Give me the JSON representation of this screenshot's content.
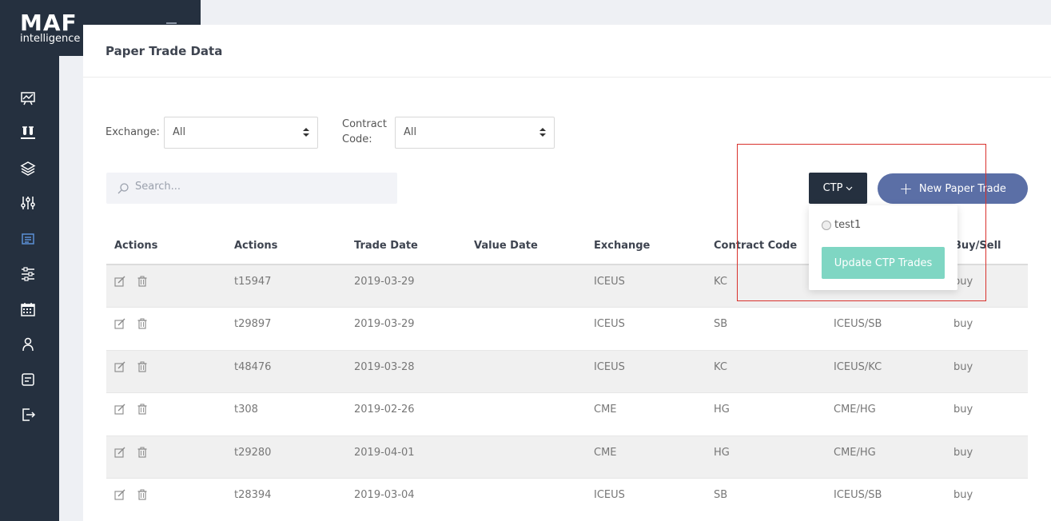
{
  "brand": {
    "name": "MAF",
    "sub": "intelligence"
  },
  "nav_icons": [
    "chart-icon",
    "lab-icon",
    "layers-icon",
    "sliders-icon",
    "news-icon",
    "settings-sliders-icon",
    "calendar-icon",
    "user-icon",
    "report-icon",
    "logout-icon"
  ],
  "page": {
    "title": "Paper Trade Data"
  },
  "filters": {
    "exchange_label": "Exchange:",
    "exchange_value": "All",
    "contract_label_1": "Contract",
    "contract_label_2": "Code:",
    "contract_value": "All"
  },
  "search": {
    "placeholder": "Search..."
  },
  "toolbar": {
    "ctp_label": "CTP",
    "new_trade_label": "New Paper Trade"
  },
  "dropdown": {
    "option_label": "test1",
    "update_label": "Update CTP Trades"
  },
  "table": {
    "headers": [
      "Actions",
      "Actions",
      "Trade Date",
      "Value Date",
      "Exchange",
      "Contract Code",
      "",
      "Buy/Sell"
    ],
    "rows": [
      {
        "id": "t15947",
        "trade_date": "2019-03-29",
        "value_date": "",
        "exchange": "ICEUS",
        "contract": "KC",
        "full": "",
        "side": "buy"
      },
      {
        "id": "t29897",
        "trade_date": "2019-03-29",
        "value_date": "",
        "exchange": "ICEUS",
        "contract": "SB",
        "full": "ICEUS/SB",
        "side": "buy"
      },
      {
        "id": "t48476",
        "trade_date": "2019-03-28",
        "value_date": "",
        "exchange": "ICEUS",
        "contract": "KC",
        "full": "ICEUS/KC",
        "side": "buy"
      },
      {
        "id": "t308",
        "trade_date": "2019-02-26",
        "value_date": "",
        "exchange": "CME",
        "contract": "HG",
        "full": "CME/HG",
        "side": "buy"
      },
      {
        "id": "t29280",
        "trade_date": "2019-04-01",
        "value_date": "",
        "exchange": "CME",
        "contract": "HG",
        "full": "CME/HG",
        "side": "buy"
      },
      {
        "id": "t28394",
        "trade_date": "2019-03-04",
        "value_date": "",
        "exchange": "ICEUS",
        "contract": "SB",
        "full": "ICEUS/SB",
        "side": "buy"
      }
    ]
  },
  "colors": {
    "sidebar": "#25303f",
    "accent": "#5b6fa6",
    "update": "#7fd6c3",
    "highlight": "#d9322d"
  }
}
